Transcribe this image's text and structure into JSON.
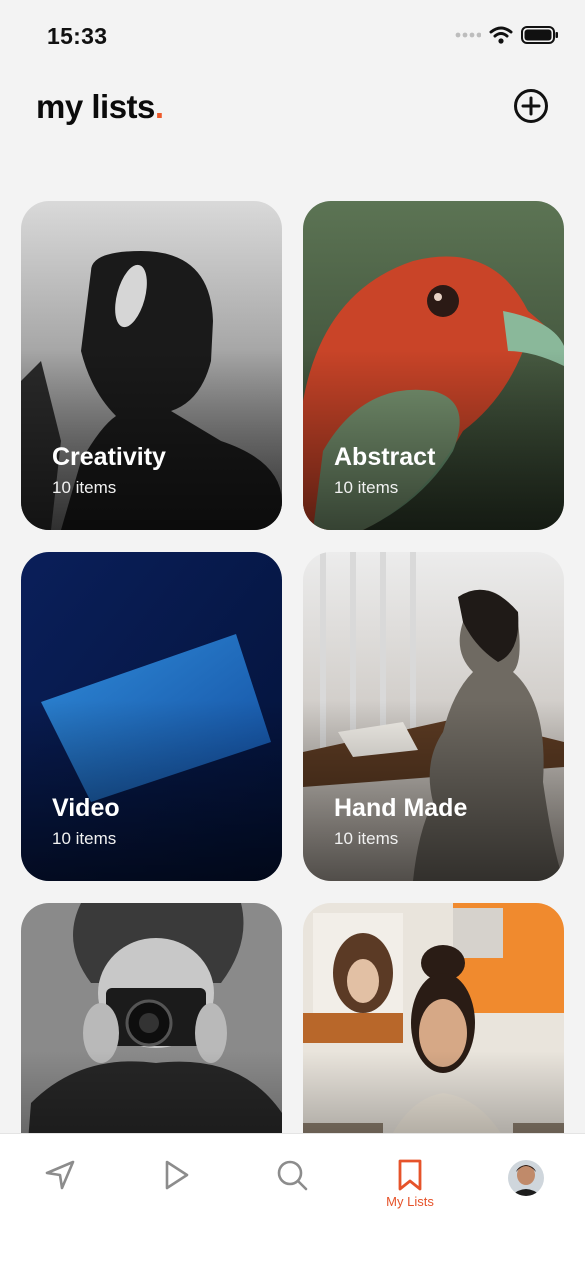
{
  "status": {
    "time": "15:33"
  },
  "header": {
    "title": "my lists",
    "title_dot": "."
  },
  "lists": [
    {
      "title": "Creativity",
      "count": "10 items"
    },
    {
      "title": "Abstract",
      "count": "10 items"
    },
    {
      "title": "Video",
      "count": "10 items"
    },
    {
      "title": "Hand Made",
      "count": "10 items"
    },
    {
      "title": "",
      "count": ""
    },
    {
      "title": "",
      "count": ""
    }
  ],
  "tabbar": {
    "active_label": "My Lists"
  },
  "icons": [
    "navigation-icon",
    "play-icon",
    "search-icon",
    "bookmark-icon",
    "avatar"
  ],
  "colors": {
    "accent": "#ee5a2a",
    "background": "#f3f3f3"
  }
}
